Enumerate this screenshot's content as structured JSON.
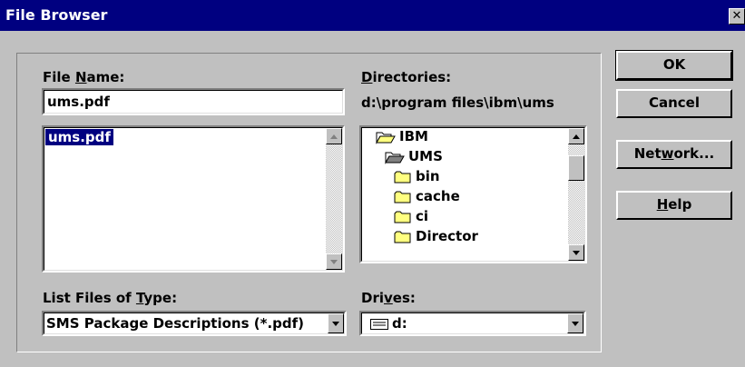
{
  "window": {
    "title": "File Browser",
    "close_glyph": "✕"
  },
  "file_name": {
    "label_pre": "File ",
    "label_accel": "N",
    "label_post": "ame:",
    "value": "ums.pdf",
    "files": [
      "ums.pdf"
    ]
  },
  "directories": {
    "label_accel": "D",
    "label_post": "irectories:",
    "path": "d:\\program files\\ibm\\ums",
    "items": [
      {
        "name": "IBM",
        "icon": "folder-open-icon"
      },
      {
        "name": "UMS",
        "icon": "folder-open-icon"
      },
      {
        "name": "bin",
        "icon": "folder-icon"
      },
      {
        "name": "cache",
        "icon": "folder-icon"
      },
      {
        "name": "ci",
        "icon": "folder-icon"
      },
      {
        "name": "Director",
        "icon": "folder-icon"
      }
    ]
  },
  "file_type": {
    "label_pre": "List Files of ",
    "label_accel": "T",
    "label_post": "ype:",
    "selected": "SMS Package Descriptions (*.pdf)"
  },
  "drives": {
    "label_pre": "Dri",
    "label_accel": "v",
    "label_post": "es:",
    "selected": "d:",
    "icon": "drive-icon"
  },
  "buttons": {
    "ok": "OK",
    "cancel": "Cancel",
    "network": {
      "pre": "Net",
      "accel": "w",
      "post": "ork..."
    },
    "help": {
      "pre": "",
      "accel": "H",
      "post": "elp"
    }
  },
  "colors": {
    "titlebar": "#000080",
    "face": "#c0c0c0",
    "selection": "#000080"
  }
}
